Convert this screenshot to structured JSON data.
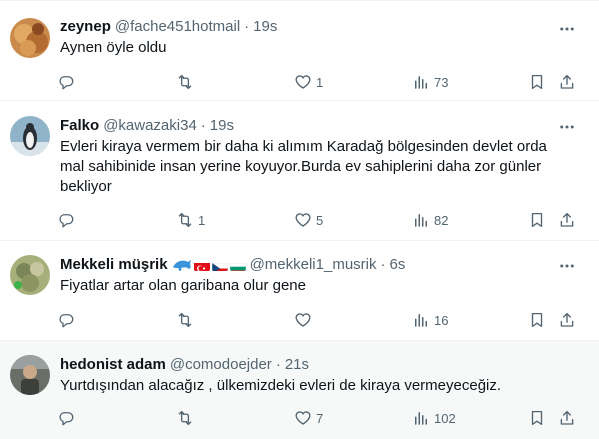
{
  "tweets": [
    {
      "name": "zeynep",
      "handle": "@fache451hotmail",
      "time": "19s",
      "text": [
        "Aynen öyle oldu"
      ],
      "replies": "",
      "retweets": "",
      "likes": "1",
      "views": "73",
      "highlighted": false
    },
    {
      "name": "Falko",
      "handle": "@kawazaki34",
      "time": "19s",
      "text": [
        "Evleri kiraya vermem bir daha ki alımım Karadağ bölgesinden devlet orda",
        "mal sahibinide insan yerine koyuyor.Burda ev sahiplerini daha zor günler",
        "bekliyor"
      ],
      "replies": "",
      "retweets": "1",
      "likes": "5",
      "views": "82",
      "highlighted": false
    },
    {
      "name": "Mekkeli müşrik",
      "handle": "@mekkeli1_musrik",
      "time": "6s",
      "emojis": [
        "dolphin-emoji",
        "turkey-flag",
        "czech-flag",
        "bulgaria-flag"
      ],
      "text": [
        "Fiyatlar artar olan garibana olur gene"
      ],
      "replies": "",
      "retweets": "",
      "likes": "",
      "views": "16",
      "highlighted": false
    },
    {
      "name": "hedonist adam",
      "handle": "@comodoejder",
      "time": "21s",
      "text": [
        "Yurtdışından alacağız , ülkemizdeki evleri de kiraya vermeyeceğiz."
      ],
      "replies": "",
      "retweets": "",
      "likes": "7",
      "views": "102",
      "highlighted": true
    }
  ],
  "separator": "·",
  "colors": {
    "text": "#0f1419",
    "secondary": "#536471",
    "border": "#eff3f4",
    "hover_bg": "#f7f9f9"
  }
}
